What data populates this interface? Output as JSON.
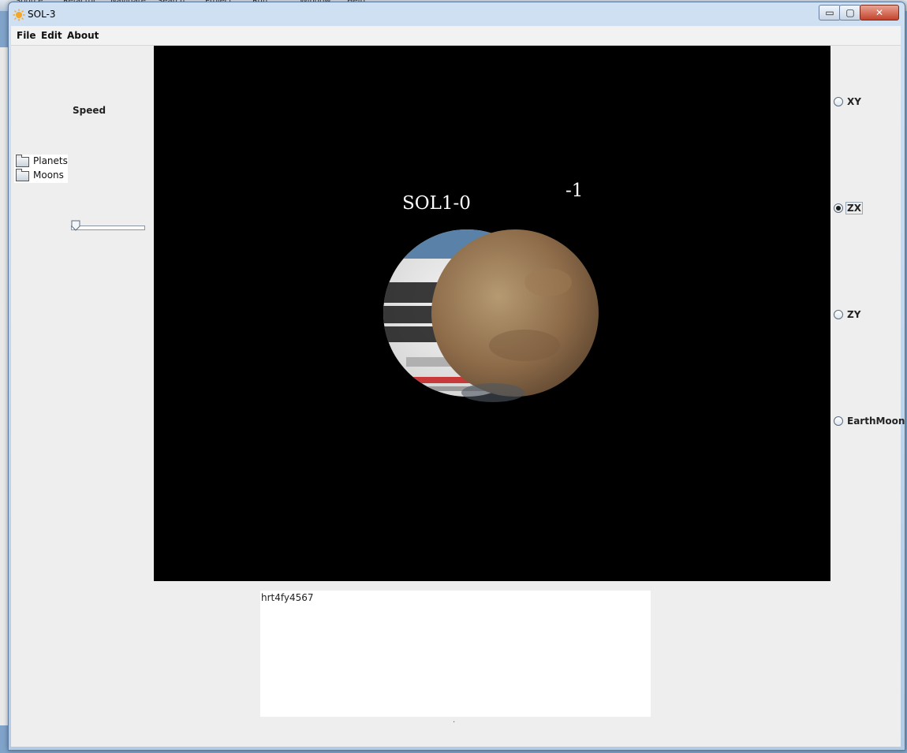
{
  "window": {
    "title": "SOL-3",
    "min_glyph": "▭",
    "max_glyph": "▢",
    "close_glyph": "✕"
  },
  "background_ide_menu": [
    "Source",
    "Refactor",
    "Navigate",
    "Search",
    "Project",
    "Run",
    "Window",
    "Help"
  ],
  "menubar": {
    "file": "File",
    "edit": "Edit",
    "about": "About"
  },
  "left_panel": {
    "speed_label": "Speed",
    "tree": [
      {
        "label": "Planets"
      },
      {
        "label": "Moons"
      }
    ],
    "speed_slider_value": 0
  },
  "viewport": {
    "label_main": "SOL1-0",
    "label_secondary": "-1",
    "background_color": "#000000",
    "bodies": [
      "newspaper-textured sphere",
      "mars-textured sphere"
    ]
  },
  "view_options": {
    "xy": "XY",
    "zx": "ZX",
    "zy": "ZY",
    "earthmoon": "EarthMoon",
    "selected": "ZX"
  },
  "output_text": "hrt4fy4567",
  "status_dot": "·"
}
